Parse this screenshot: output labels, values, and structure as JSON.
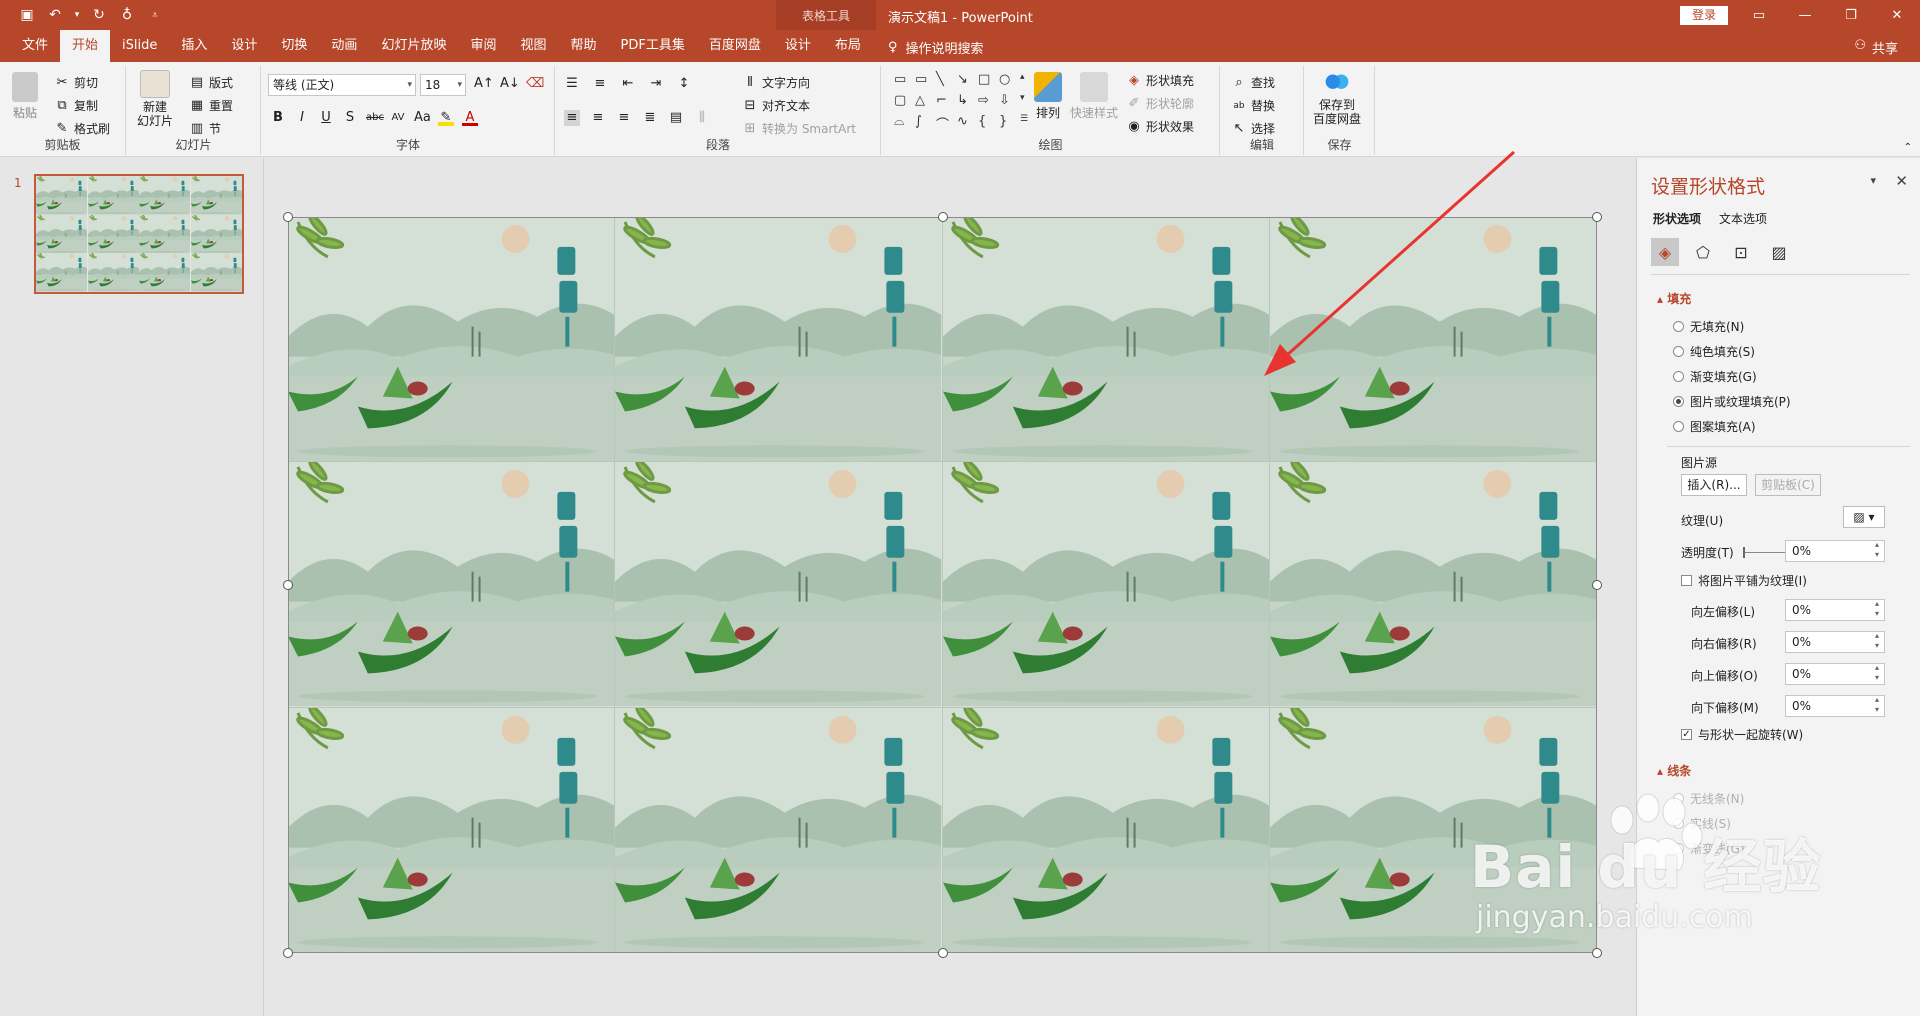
{
  "titlebar": {
    "context_label": "表格工具",
    "doc_title": "演示文稿1  -  PowerPoint",
    "login": "登录"
  },
  "tabs": [
    "文件",
    "开始",
    "iSlide",
    "插入",
    "设计",
    "切换",
    "动画",
    "幻灯片放映",
    "审阅",
    "视图",
    "帮助",
    "PDF工具集",
    "百度网盘",
    "设计",
    "布局"
  ],
  "active_tab": "开始",
  "tellme": "操作说明搜索",
  "share": "共享",
  "ribbon": {
    "clipboard": {
      "paste": "粘贴",
      "cut": "剪切",
      "copy": "复制",
      "format_painter": "格式刷",
      "label": "剪贴板"
    },
    "slides": {
      "new_slide_line1": "新建",
      "new_slide_line2": "幻灯片",
      "layout": "版式",
      "reset": "重置",
      "section": "节",
      "label": "幻灯片"
    },
    "font": {
      "name": "等线 (正文)",
      "size": "18",
      "label": "字体"
    },
    "paragraph": {
      "text_direction": "文字方向",
      "align_text": "对齐文本",
      "smartart": "转换为 SmartArt",
      "label": "段落"
    },
    "drawing": {
      "arrange": "排列",
      "quick_styles": "快速样式",
      "shape_fill": "形状填充",
      "shape_outline": "形状轮廓",
      "shape_effects": "形状效果",
      "label": "绘图"
    },
    "editing": {
      "find": "查找",
      "replace": "替换",
      "select": "选择",
      "label": "编辑"
    },
    "save": {
      "save_line1": "保存到",
      "save_line2": "百度网盘",
      "label": "保存"
    }
  },
  "thumbnail": {
    "number": "1"
  },
  "format_pane": {
    "title": "设置形状格式",
    "tab_shape": "形状选项",
    "tab_text": "文本选项",
    "fill_header": "填充",
    "fill_options": [
      "无填充(N)",
      "纯色填充(S)",
      "渐变填充(G)",
      "图片或纹理填充(P)",
      "图案填充(A)"
    ],
    "fill_selected_index": 3,
    "picture_source": "图片源",
    "insert_btn": "插入(R)...",
    "clipboard_btn": "剪贴板(C)",
    "texture": "纹理(U)",
    "transparency": "透明度(T)",
    "transparency_value": "0%",
    "tile_checkbox": "将图片平铺为纹理(I)",
    "offset_left": "向左偏移(L)",
    "offset_left_value": "0%",
    "offset_right": "向右偏移(R)",
    "offset_right_value": "0%",
    "offset_up": "向上偏移(O)",
    "offset_up_value": "0%",
    "offset_down": "向下偏移(M)",
    "offset_down_value": "0%",
    "rotate_checkbox": "与形状一起旋转(W)",
    "line_header": "线条",
    "line_options": [
      "无线条(N)",
      "实线(S)",
      "渐变线(G)"
    ]
  },
  "watermark": {
    "main": "Bai du 经验",
    "sub": "jingyan.baidu.com"
  },
  "colors": {
    "accent": "#b7472a",
    "ribbon_bg": "#f3f3f3",
    "arrow": "#e8342e"
  }
}
